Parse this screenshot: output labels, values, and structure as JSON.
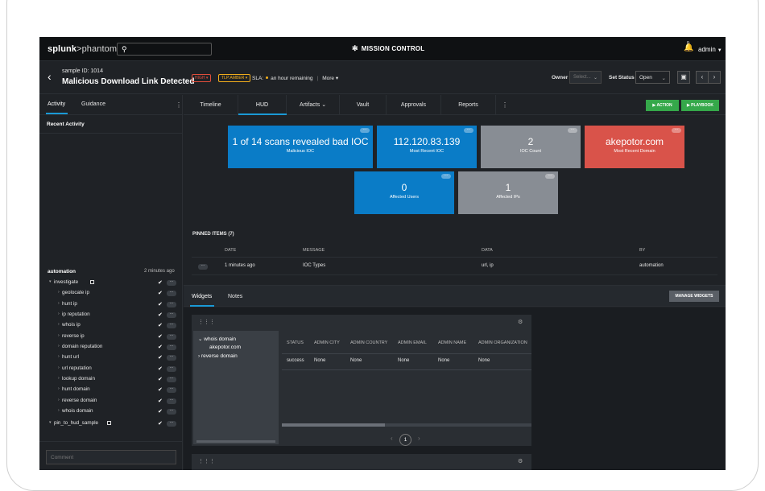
{
  "topbar": {
    "logo_main": "splunk",
    "logo_rest": ">phantom",
    "mission_control": "MISSION CONTROL",
    "notification_count": "0",
    "user": "admin"
  },
  "header": {
    "sample_id": "sample ID: 1014",
    "title": "Malicious Download Link Detected",
    "severity": "HIGH",
    "tlp": "TLP:AMBER",
    "sla_label": "SLA:",
    "sla_value": "an hour remaining",
    "more": "More",
    "owner_label": "Owner",
    "owner_placeholder": "Select...",
    "status_label": "Set Status",
    "status_value": "Open"
  },
  "left_panel": {
    "tabs": [
      "Activity",
      "Guidance"
    ],
    "recent_activity": "Recent Activity",
    "automation_name": "automation",
    "automation_time": "2 minutes ago",
    "tree": [
      {
        "label": "investigate",
        "level": 0,
        "expanded": true
      },
      {
        "label": "geolocate ip",
        "level": 1
      },
      {
        "label": "hunt ip",
        "level": 1
      },
      {
        "label": "ip reputation",
        "level": 1
      },
      {
        "label": "whois ip",
        "level": 1
      },
      {
        "label": "reverse ip",
        "level": 1
      },
      {
        "label": "domain reputation",
        "level": 1
      },
      {
        "label": "hunt url",
        "level": 1
      },
      {
        "label": "url reputation",
        "level": 1
      },
      {
        "label": "lookup domain",
        "level": 1
      },
      {
        "label": "hunt domain",
        "level": 1
      },
      {
        "label": "reverse domain",
        "level": 1
      },
      {
        "label": "whois domain",
        "level": 1
      },
      {
        "label": "pin_to_hud_sample",
        "level": 0,
        "expanded": true
      }
    ],
    "comment_placeholder": "Comment"
  },
  "tabs": {
    "items": [
      "Timeline",
      "HUD",
      "Artifacts",
      "Vault",
      "Approvals",
      "Reports"
    ],
    "active": "HUD",
    "action_button": "ACTION",
    "playbook_button": "PLAYBOOK"
  },
  "hud": {
    "tiles": [
      {
        "value": "1 of 14 scans revealed bad IOC",
        "label": "Malicious IOC",
        "color": "#0a7cc7"
      },
      {
        "value": "112.120.83.139",
        "label": "Most Recent IOC",
        "color": "#0a7cc7"
      },
      {
        "value": "2",
        "label": "IOC Count",
        "color": "#888d94"
      },
      {
        "value": "akepotor.com",
        "label": "Most Recent Domain",
        "color": "#d9534a"
      },
      {
        "value": "0",
        "label": "Affected Users",
        "color": "#0a7cc7"
      },
      {
        "value": "1",
        "label": "Affected IPs",
        "color": "#888d94"
      }
    ],
    "pinned_title": "PINNED ITEMS (7)",
    "pinned_headers": [
      "DATE",
      "MESSAGE",
      "DATA",
      "BY"
    ],
    "pinned_rows": [
      [
        "1 minutes ago",
        "IOC Types",
        "url, ip",
        "automation"
      ]
    ]
  },
  "widgets_bar": {
    "tabs": [
      "Widgets",
      "Notes"
    ],
    "manage_button": "MANAGE WIDGETS"
  },
  "widget": {
    "tree": [
      "whois domain",
      "akepotor.com",
      "reverse domain"
    ],
    "headers": [
      "STATUS",
      "ADMIN CITY",
      "ADMIN COUNTRY",
      "ADMIN EMAIL",
      "ADMIN NAME",
      "ADMIN ORGANIZATION"
    ],
    "row": [
      "success",
      "None",
      "None",
      "None",
      "None",
      "None"
    ],
    "page": "1"
  },
  "icons": {
    "search": "search-icon",
    "bell": "bell-icon",
    "back": "back-arrow-icon",
    "gear": "gear-icon",
    "grip": "grip-icon",
    "briefcase": "briefcase-icon"
  },
  "colors": {
    "accent": "#1a9ad6",
    "green": "#35a84a",
    "high": "#e04e3b",
    "amber": "#f0ac1c"
  }
}
